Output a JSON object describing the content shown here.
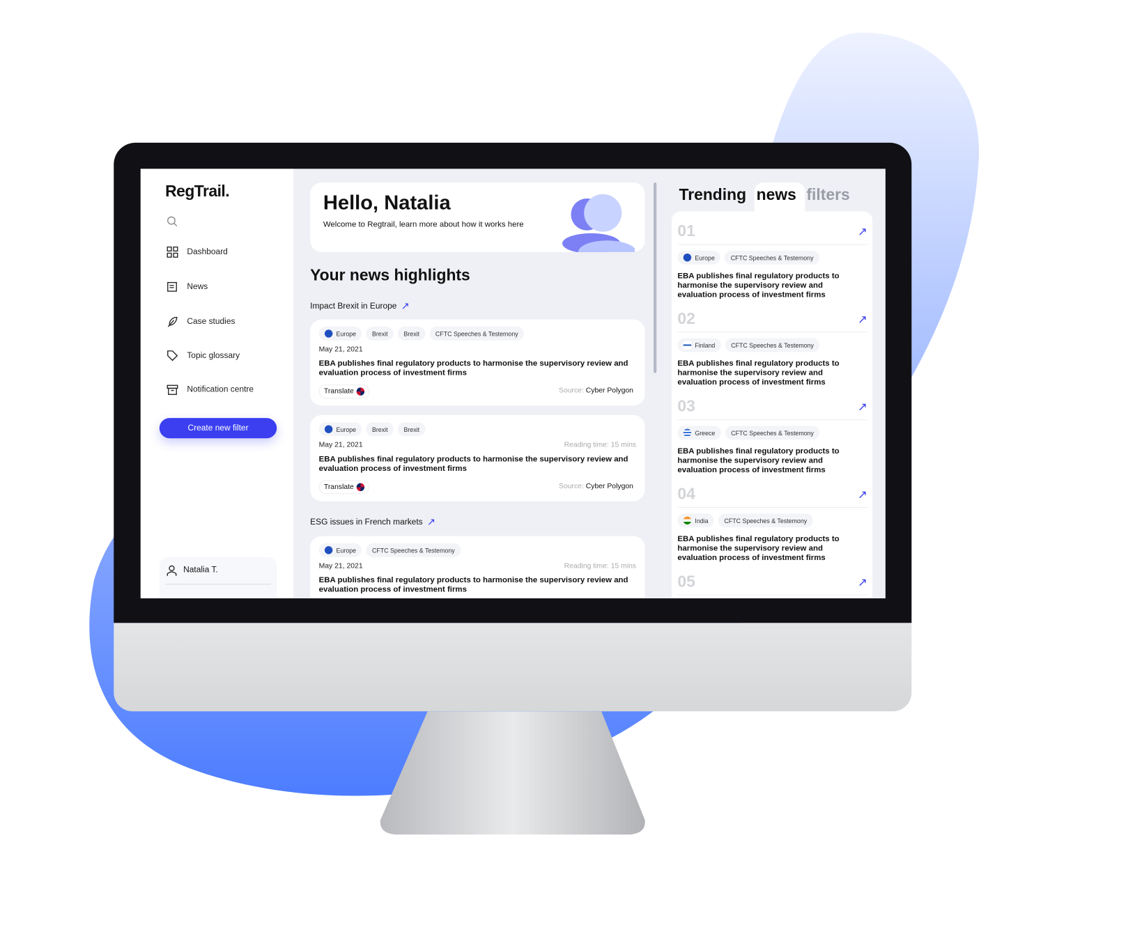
{
  "colors": {
    "accent": "#3b3ff0",
    "blob_top": "#e8eeff",
    "blob_bottom": "#4d7dff",
    "bezel": "#101015"
  },
  "sidebar": {
    "logo": "RegTrail.",
    "search_icon": "search-icon",
    "items": [
      {
        "label": "Dashboard",
        "icon": "grid-icon"
      },
      {
        "label": "News",
        "icon": "newspaper-icon"
      },
      {
        "label": "Case studies",
        "icon": "feather-icon"
      },
      {
        "label": "Topic glossary",
        "icon": "tag-icon"
      },
      {
        "label": "Notification centre",
        "icon": "archive-icon"
      }
    ],
    "create_button": "Create new filter",
    "user": "Natalia T."
  },
  "hello": {
    "title": "Hello, Natalia",
    "subtitle": "Welcome to Regtrail, learn more about how it works here"
  },
  "highlights": {
    "title": "Your news highlights",
    "sections": [
      {
        "label": "Impact Brexit in Europe",
        "cards": [
          {
            "tags": [
              "Europe",
              "Brexit",
              "Brexit",
              "CFTC Speeches & Testemony"
            ],
            "date": "May 21, 2021",
            "reading_time": "",
            "title": "EBA publishes final regulatory products to harmonise the supervisory review and evaluation process of investment firms",
            "translate": "Translate",
            "source_label": "Source:",
            "source": "Cyber Polygon"
          },
          {
            "tags": [
              "Europe",
              "Brexit",
              "Brexit"
            ],
            "date": "May 21, 2021",
            "reading_time": "Reading time: 15 mins",
            "title": "EBA publishes final regulatory products to harmonise the supervisory review and evaluation process of investment firms",
            "translate": "Translate",
            "source_label": "Source:",
            "source": "Cyber Polygon"
          }
        ]
      },
      {
        "label": "ESG issues in French markets",
        "cards": [
          {
            "tags": [
              "Europe",
              "CFTC Speeches & Testemony"
            ],
            "date": "May 21, 2021",
            "reading_time": "Reading time: 15 mins",
            "title": "EBA publishes final regulatory products to harmonise the supervisory review and evaluation process of investment firms"
          }
        ]
      }
    ]
  },
  "trending": {
    "tabs": [
      "Trending",
      "news",
      "filters"
    ],
    "items": [
      {
        "num": "01",
        "country": "Europe",
        "tag": "CFTC Speeches & Testemony",
        "title": "EBA publishes final regulatory products to harmonise the supervisory review and evaluation process of investment firms"
      },
      {
        "num": "02",
        "country": "Finland",
        "tag": "CFTC Speeches & Testemony",
        "title": "EBA publishes final regulatory products to harmonise the supervisory review and evaluation process of investment firms"
      },
      {
        "num": "03",
        "country": "Greece",
        "tag": "CFTC Speeches & Testemony",
        "title": "EBA publishes final regulatory products to harmonise the supervisory review and evaluation process of investment firms"
      },
      {
        "num": "04",
        "country": "India",
        "tag": "CFTC Speeches & Testemony",
        "title": "EBA publishes final regulatory products to harmonise the supervisory review and evaluation process of investment firms"
      },
      {
        "num": "05"
      }
    ]
  }
}
